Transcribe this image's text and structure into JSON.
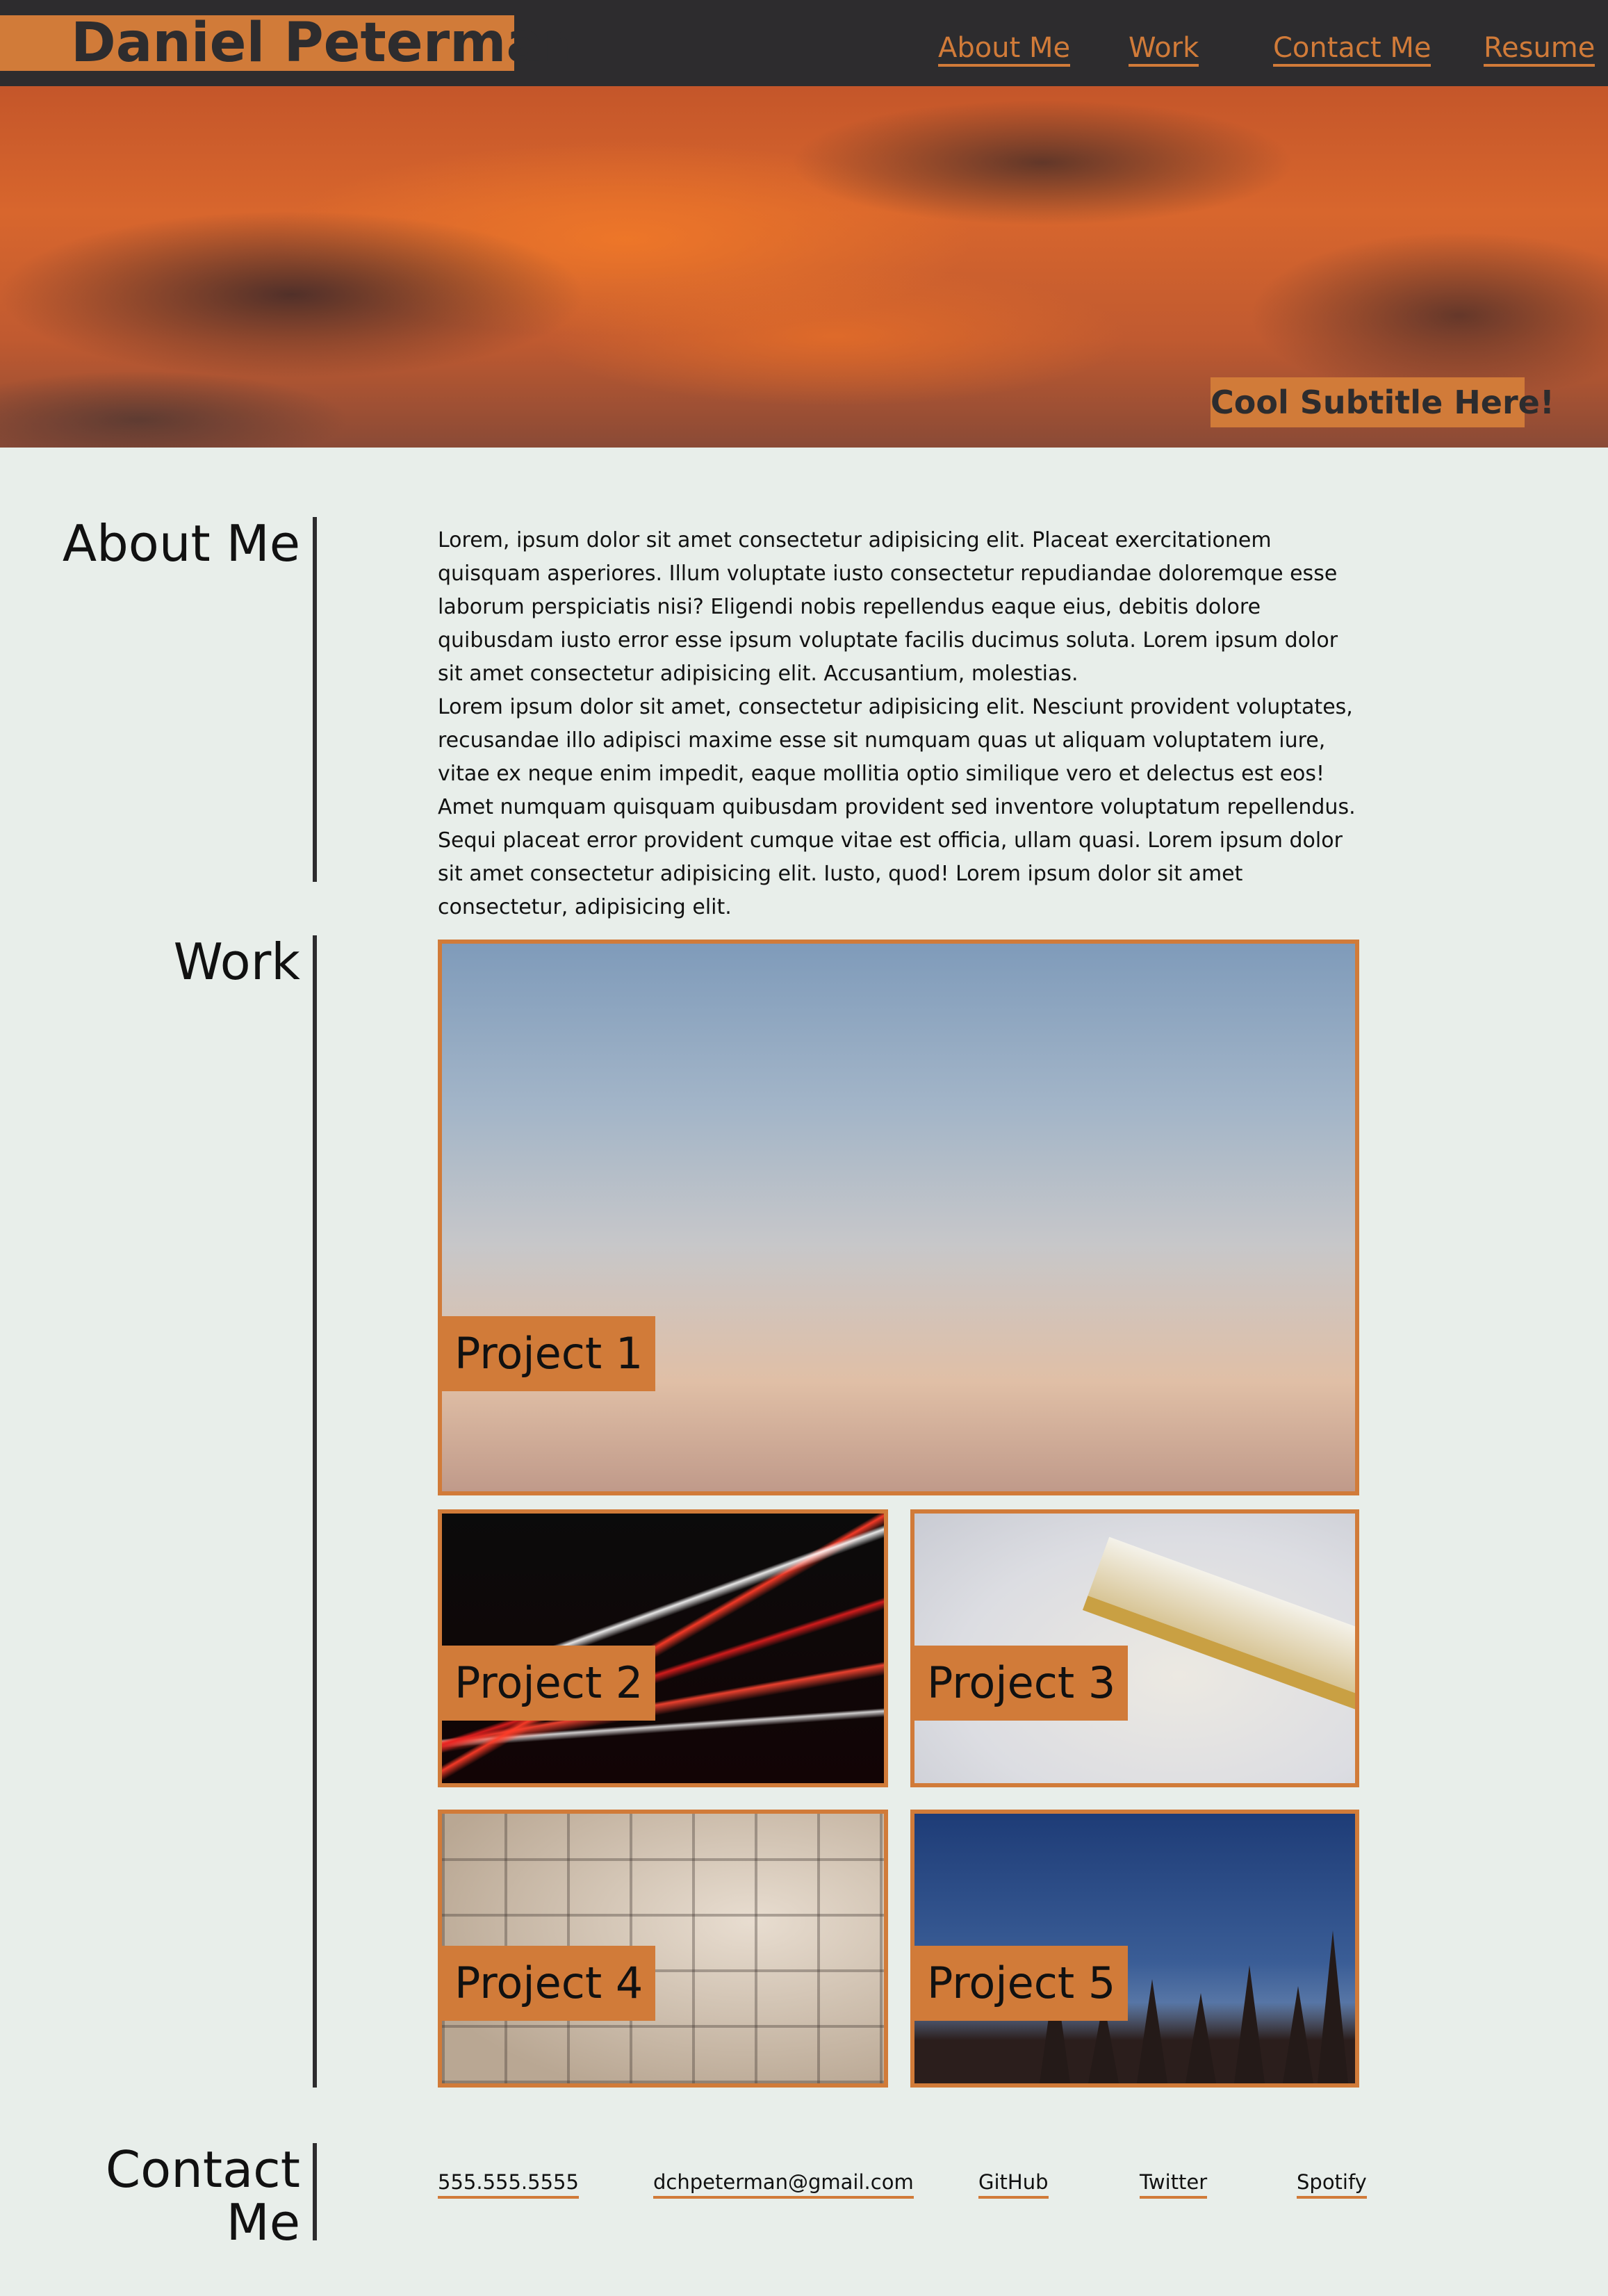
{
  "header": {
    "brand": "Daniel Peterman",
    "nav": [
      "About Me",
      "Work",
      "Contact Me",
      "Resume"
    ]
  },
  "hero": {
    "subtitle": "Cool Subtitle Here!"
  },
  "about": {
    "title": "About Me",
    "paragraphs": [
      "Lorem, ipsum dolor sit amet consectetur adipisicing elit. Placeat exercitationem quisquam asperiores. Illum voluptate iusto consectetur repudiandae doloremque esse laborum perspiciatis nisi? Eligendi nobis repellendus eaque eius, debitis dolore quibusdam iusto error esse ipsum voluptate facilis ducimus soluta. Lorem ipsum dolor sit amet consectetur adipisicing elit. Accusantium, molestias.",
      "Lorem ipsum dolor sit amet, consectetur adipisicing elit. Nesciunt provident voluptates, recusandae illo adipisci maxime esse sit numquam quas ut aliquam voluptatem iure, vitae ex neque enim impedit, eaque mollitia optio similique vero et delectus est eos! Amet numquam quisquam quibusdam provident sed inventore voluptatum repellendus. Sequi placeat error provident cumque vitae est officia, ullam quasi. Lorem ipsum dolor sit amet consectetur adipisicing elit. Iusto, quod! Lorem ipsum dolor sit amet consectetur, adipisicing elit."
    ]
  },
  "work": {
    "title": "Work",
    "projects": [
      "Project 1",
      "Project 2",
      "Project 3",
      "Project 4",
      "Project 5"
    ]
  },
  "contact": {
    "title_line1": "Contact",
    "title_line2": "Me",
    "phone": "555.555.5555",
    "email": "dchpeterman@gmail.com",
    "links": [
      "GitHub",
      "Twitter",
      "Spotify"
    ]
  },
  "colors": {
    "accent": "#d17b39",
    "dark": "#2d2c2e",
    "background": "#e8eeea"
  }
}
